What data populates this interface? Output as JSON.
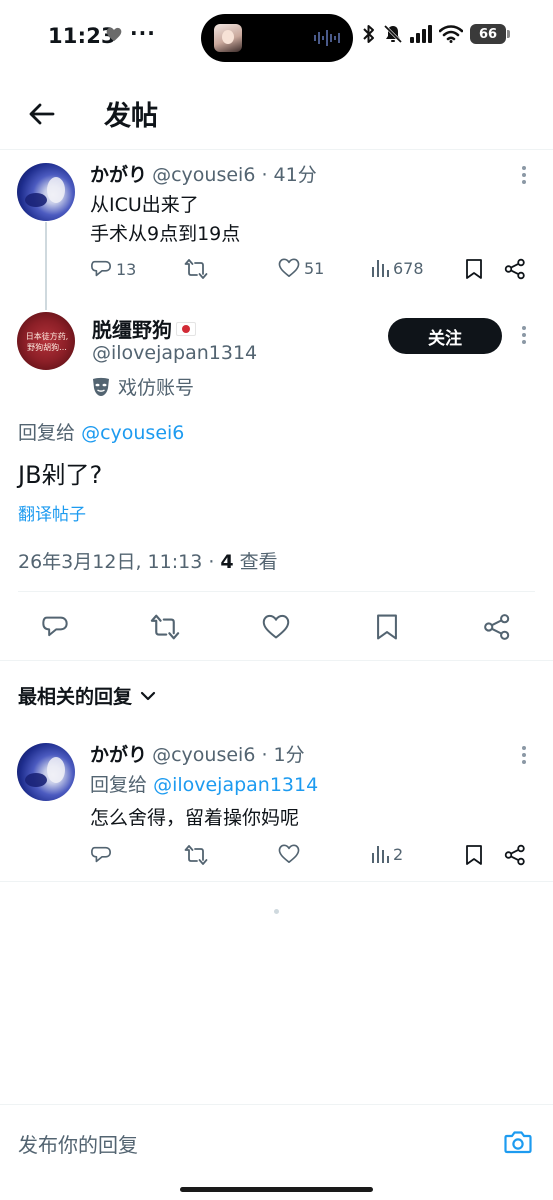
{
  "status_bar": {
    "time": "11:23",
    "more": "···",
    "battery": "66"
  },
  "header": {
    "title": "发帖"
  },
  "parent_post": {
    "name": "かがり",
    "handle_time": "@cyousei6 · 41分",
    "lines": [
      "从ICU出来了",
      "手术从9点到19点"
    ],
    "replies": "13",
    "likes": "51",
    "views": "678"
  },
  "main_post": {
    "name": "脱缰野狗",
    "handle": "@ilovejapan1314",
    "label": "戏仿账号",
    "follow_label": "关注",
    "avatar_text": "日本徒方药,\n野狗胡狗...",
    "reply_prefix": "回复给",
    "reply_mention": "@cyousei6",
    "text": "JB剁了?",
    "translate_label": "翻译帖子",
    "date": "26年3月12日, 11:13 · ",
    "views_count": "4",
    "views_label": " 查看"
  },
  "replies_sort": {
    "label": "最相关的回复"
  },
  "reply": {
    "name": "かがり",
    "handle_time": "@cyousei6 · 1分",
    "reply_prefix": "回复给",
    "reply_mention": "@ilovejapan1314",
    "text": "怎么舍得，留着操你妈呢",
    "views": "2"
  },
  "composer": {
    "placeholder": "发布你的回复"
  },
  "colors": {
    "accent": "#1d9bf0",
    "text": "#0f1419",
    "muted": "#536471",
    "follow_bg": "#0f1419"
  },
  "icons": [
    "back-arrow-icon",
    "more-icon",
    "reply-icon",
    "retweet-icon",
    "like-icon",
    "views-icon",
    "bookmark-icon",
    "share-icon",
    "chevron-down-icon",
    "camera-icon",
    "parody-mask-icon"
  ]
}
